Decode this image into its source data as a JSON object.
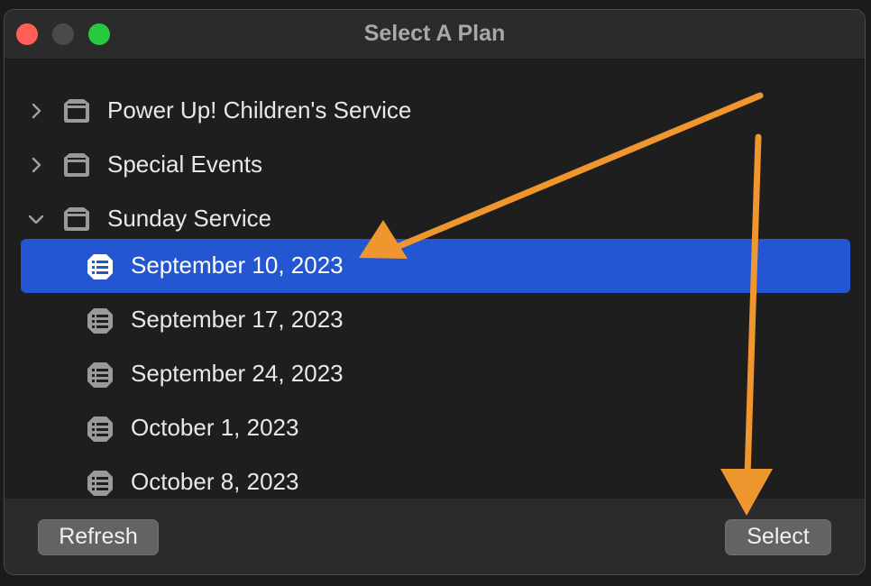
{
  "window": {
    "title": "Select A Plan"
  },
  "folders": [
    {
      "label": "Power Up! Children's Service",
      "expanded": false,
      "icon": "folder-icon"
    },
    {
      "label": "Special Events",
      "expanded": false,
      "icon": "folder-icon"
    },
    {
      "label": "Sunday Service",
      "expanded": true,
      "icon": "folder-icon"
    }
  ],
  "plans": [
    {
      "label": "September 10, 2023",
      "selected": true,
      "icon": "plan-list-icon"
    },
    {
      "label": "September 17, 2023",
      "selected": false,
      "icon": "plan-list-icon"
    },
    {
      "label": "September 24, 2023",
      "selected": false,
      "icon": "plan-list-icon"
    },
    {
      "label": "October 1, 2023",
      "selected": false,
      "icon": "plan-list-icon"
    },
    {
      "label": "October 8, 2023",
      "selected": false,
      "icon": "plan-list-icon"
    }
  ],
  "footer": {
    "refresh_label": "Refresh",
    "select_label": "Select"
  },
  "colors": {
    "selection": "#2356d0",
    "annotation_arrow": "#f0962e",
    "close": "#ff5f57",
    "maximize": "#28c840"
  }
}
